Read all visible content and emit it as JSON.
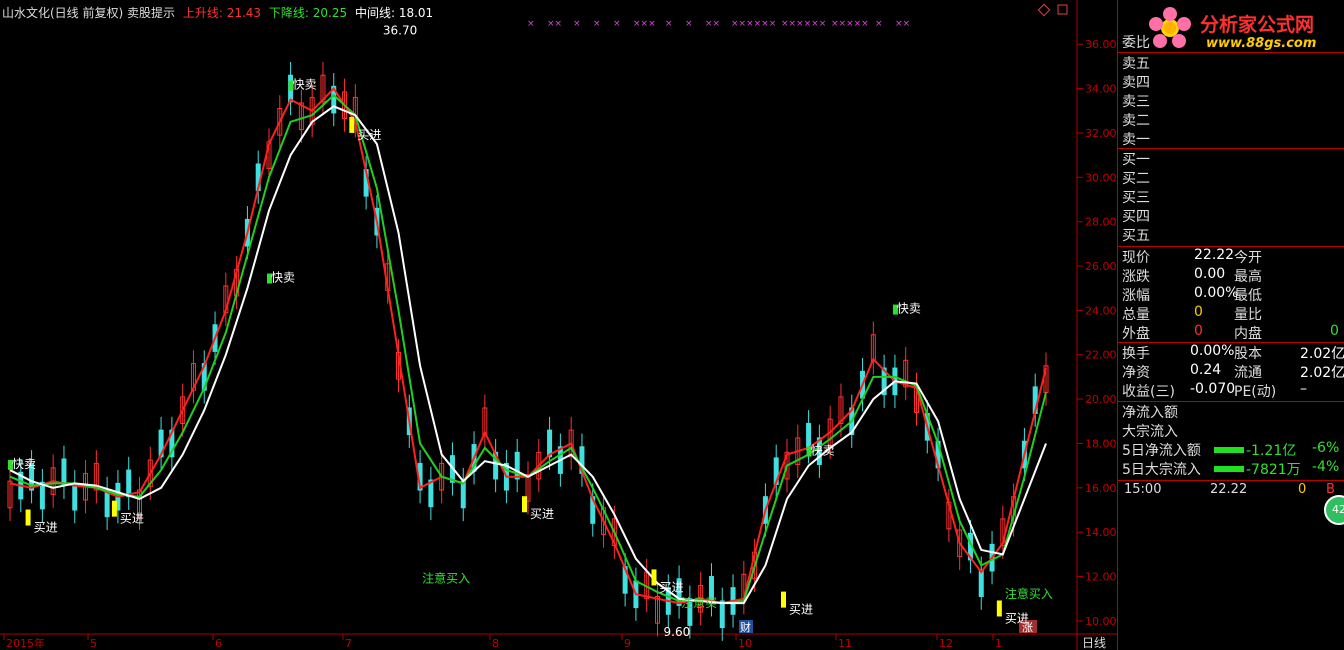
{
  "header": {
    "title": "山水文化(日线 前复权) 卖股提示",
    "up_label": "上升线:",
    "up_value": "21.43",
    "down_label": "下降线:",
    "down_value": "20.25",
    "mid_label": "中间线:",
    "mid_value": "18.01"
  },
  "colors": {
    "background": "#000000",
    "up_line": "#ff2020",
    "down_line": "#20d020",
    "mid_line": "#ffffff",
    "candle_up": "#ff3030",
    "candle_down": "#40e0e0",
    "signal_bar": "#ffff00",
    "axis_text": "#c00000",
    "x_marks": "#e040e0"
  },
  "chart_data": {
    "type": "line",
    "title": "山水文化(日线 前复权) 卖股提示",
    "x_labels": [
      "2015年",
      "5",
      "6",
      "7",
      "8",
      "9",
      "10",
      "11",
      "12",
      "1",
      "2"
    ],
    "ylim": [
      9.5,
      37.0
    ],
    "y_ticks": [
      "36.00",
      "34.00",
      "32.00",
      "30.00",
      "28.00",
      "26.00",
      "24.00",
      "22.00",
      "20.00",
      "18.00",
      "16.00",
      "14.00",
      "12.00",
      "10.00"
    ],
    "series": [
      {
        "name": "上升线",
        "values": [
          16.2,
          16.0,
          16.3,
          16.1,
          16.0,
          15.6,
          15.8,
          17.5,
          19.5,
          21.5,
          24.0,
          27.5,
          31.5,
          33.5,
          33.0,
          34.0,
          32.5,
          28.0,
          22.0,
          16.0,
          16.5,
          16.2,
          18.5,
          16.5,
          16.5,
          17.5,
          18.0,
          15.5,
          13.5,
          11.2,
          11.0,
          10.8,
          11.0,
          10.8,
          11.0,
          15.0,
          17.5,
          17.8,
          18.5,
          19.5,
          21.8,
          20.8,
          20.5,
          17.0,
          13.5,
          12.2,
          13.5,
          17.5,
          21.4
        ]
      },
      {
        "name": "下降线",
        "values": [
          16.5,
          16.1,
          16.2,
          16.2,
          16.0,
          15.7,
          15.6,
          16.8,
          18.5,
          20.5,
          23.0,
          26.5,
          30.0,
          32.5,
          32.8,
          33.7,
          32.8,
          29.5,
          24.0,
          18.0,
          16.5,
          16.2,
          17.8,
          16.8,
          16.5,
          17.2,
          17.8,
          16.0,
          14.0,
          11.8,
          11.3,
          10.9,
          10.9,
          10.8,
          10.9,
          14.0,
          17.0,
          17.5,
          18.2,
          19.0,
          21.0,
          21.0,
          20.6,
          18.0,
          14.5,
          12.5,
          13.0,
          16.5,
          20.3
        ]
      },
      {
        "name": "中间线",
        "values": [
          16.8,
          16.3,
          16.0,
          16.2,
          16.1,
          15.8,
          15.5,
          16.0,
          17.5,
          19.5,
          22.0,
          25.0,
          28.5,
          31.0,
          32.5,
          33.2,
          32.8,
          31.5,
          27.5,
          21.5,
          17.5,
          16.3,
          17.2,
          17.0,
          16.5,
          17.0,
          17.5,
          16.5,
          14.8,
          12.8,
          11.7,
          11.0,
          10.9,
          10.8,
          10.8,
          12.5,
          15.5,
          17.0,
          17.8,
          18.5,
          20.0,
          20.8,
          20.7,
          19.0,
          15.5,
          13.2,
          13.0,
          15.5,
          18.0
        ]
      }
    ],
    "annotations": [
      {
        "text": "36.70",
        "x": 17,
        "y": 36.7
      },
      {
        "text": "9.60",
        "x": 30,
        "y": 9.6
      },
      {
        "text": "快卖",
        "x": 0,
        "y": 16.9
      },
      {
        "text": "快卖",
        "x": 13,
        "y": 34.0
      },
      {
        "text": "快卖",
        "x": 12,
        "y": 25.3
      },
      {
        "text": "快卖",
        "x": 37,
        "y": 17.5
      },
      {
        "text": "快卖",
        "x": 41,
        "y": 23.9
      },
      {
        "text": "买进",
        "x": 1,
        "y": 14.3
      },
      {
        "text": "买进",
        "x": 5,
        "y": 14.7
      },
      {
        "text": "买进",
        "x": 16,
        "y": 32.0
      },
      {
        "text": "买进",
        "x": 24,
        "y": 14.9
      },
      {
        "text": "买进",
        "x": 30,
        "y": 11.6
      },
      {
        "text": "买进",
        "x": 36,
        "y": 10.6
      },
      {
        "text": "买进",
        "x": 46,
        "y": 10.2
      },
      {
        "text": "注意买入",
        "x": 19,
        "y": 12.0
      },
      {
        "text": "注意买",
        "x": 31,
        "y": 10.9
      },
      {
        "text": "注意买入",
        "x": 46,
        "y": 11.3
      }
    ]
  },
  "x_marks": [
    "×",
    "××",
    "×",
    "×",
    "×",
    "×××",
    "×",
    "×",
    "××",
    "××××××",
    "××××××",
    "×××××",
    "×",
    "××"
  ],
  "bottom_tags": {
    "cai": "财",
    "zhang": "涨",
    "period": "日线"
  },
  "panel": {
    "logo_text": "分析家公式网",
    "logo_url": "www.88gs.com",
    "wei": "委比",
    "sell": [
      "卖五",
      "卖四",
      "卖三",
      "卖二",
      "卖一"
    ],
    "buy": [
      "买一",
      "买二",
      "买三",
      "买四",
      "买五"
    ],
    "quote": [
      {
        "l1": "现价",
        "v1": "22.22",
        "l2": "今开",
        "v2": ""
      },
      {
        "l1": "涨跌",
        "v1": "0.00",
        "l2": "最高",
        "v2": ""
      },
      {
        "l1": "涨幅",
        "v1": "0.00%",
        "l2": "最低",
        "v2": ""
      },
      {
        "l1": "总量",
        "v1": "0",
        "l2": "量比",
        "v2": ""
      },
      {
        "l1": "外盘",
        "v1": "0",
        "l2": "内盘",
        "v2": "0"
      }
    ],
    "fin": [
      {
        "l1": "换手",
        "v1": "0.00%",
        "l2": "股本",
        "v2": "2.02亿"
      },
      {
        "l1": "净资",
        "v1": "0.24",
        "l2": "流通",
        "v2": "2.02亿"
      },
      {
        "l1": "收益(三)",
        "v1": "-0.070",
        "l2": "PE(动)",
        "v2": "–"
      }
    ],
    "flow": [
      {
        "label": "净流入额",
        "v1": "",
        "v2": ""
      },
      {
        "label": "大宗流入",
        "v1": "",
        "v2": ""
      },
      {
        "label": "5日净流入额",
        "v1": "-1.21亿",
        "v2": "-6%"
      },
      {
        "label": "5日大宗流入",
        "v1": "-7821万",
        "v2": "-4%"
      }
    ],
    "tick": {
      "time": "15:00",
      "price": "22.22",
      "vol": "0",
      "flag": "B"
    },
    "badge": "42"
  }
}
